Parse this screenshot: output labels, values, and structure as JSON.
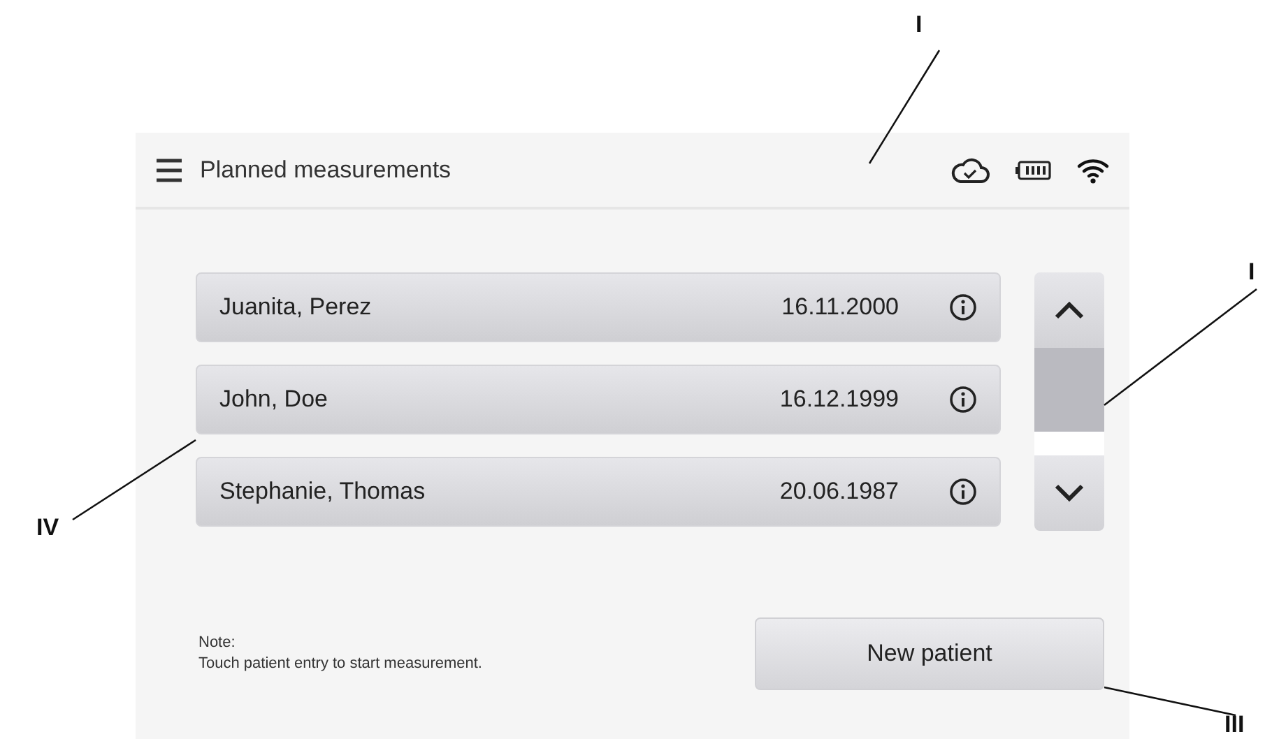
{
  "header": {
    "title": "Planned measurements"
  },
  "patients": [
    {
      "name": "Juanita, Perez",
      "birthdate": "16.11.2000"
    },
    {
      "name": "John, Doe",
      "birthdate": "16.12.1999"
    },
    {
      "name": "Stephanie, Thomas",
      "birthdate": "20.06.1987"
    }
  ],
  "note": {
    "label": "Note:",
    "text": "Touch patient entry to start measurement."
  },
  "buttons": [
    "New patient"
  ],
  "callouts": [
    {
      "label": "I"
    },
    {
      "label": "I"
    },
    {
      "label": "IV"
    },
    {
      "label": "III"
    }
  ]
}
